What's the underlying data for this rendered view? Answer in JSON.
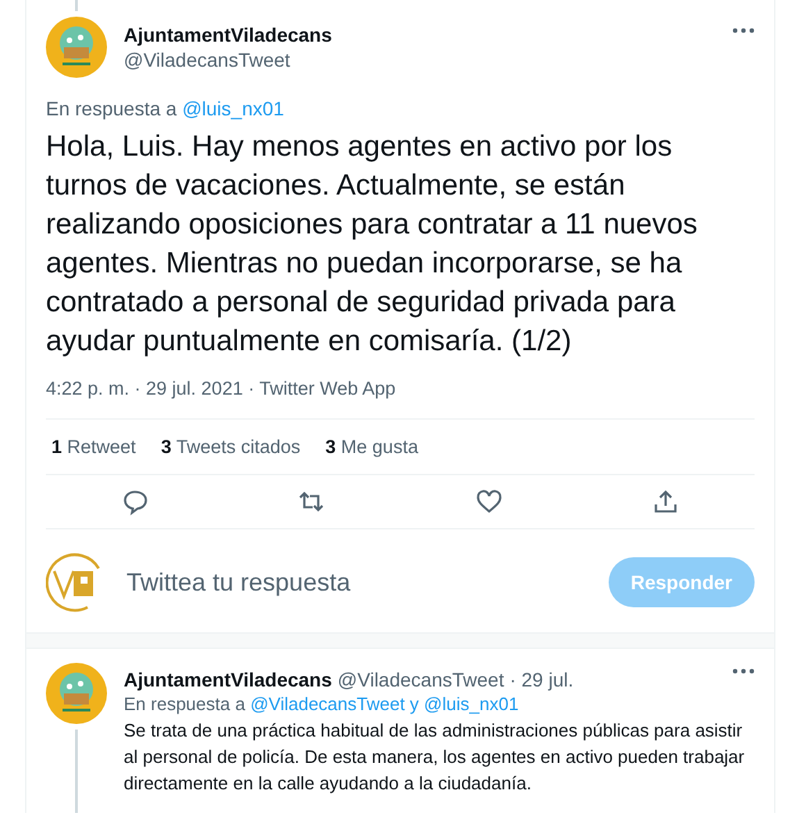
{
  "tweet": {
    "name": "AjuntamentViladecans",
    "handle": "@ViladecansTweet",
    "reply_to_label": "En respuesta a",
    "reply_to": "@luis_nx01",
    "text": "Hola, Luis. Hay menos agentes en activo por los turnos de vacaciones. Actualmente, se están realizando oposiciones para contratar a 11 nuevos agentes. Mientras no puedan incorporarse, se ha contratado a personal de seguridad privada para ayudar puntualmente en comisaría. (1/2)",
    "time": "4:22 p. m. · 29 jul. 2021 · Twitter Web App",
    "stats": [
      {
        "count": "1",
        "label": "Retweet"
      },
      {
        "count": "3",
        "label": "Tweets citados"
      },
      {
        "count": "3",
        "label": "Me gusta"
      }
    ],
    "actions": [
      {
        "kind": "reply"
      },
      {
        "kind": "retweet"
      },
      {
        "kind": "like"
      },
      {
        "kind": "share"
      }
    ]
  },
  "compose": {
    "placeholder": "Twittea tu respuesta",
    "button": {
      "label": "Responder",
      "disabled": true
    }
  },
  "reply": {
    "name": "AjuntamentViladecans",
    "handle": "@ViladecansTweet",
    "date": "· 29 jul.",
    "reply_to_label": "En respuesta a",
    "reply_to": "@ViladecansTweet y @luis_nx01",
    "text": "Se trata de una práctica habitual de las administraciones públicas para asistir al personal de policía. De esta manera, los agentes en activo pueden trabajar directamente en la calle ayudando a la ciudadanía."
  }
}
